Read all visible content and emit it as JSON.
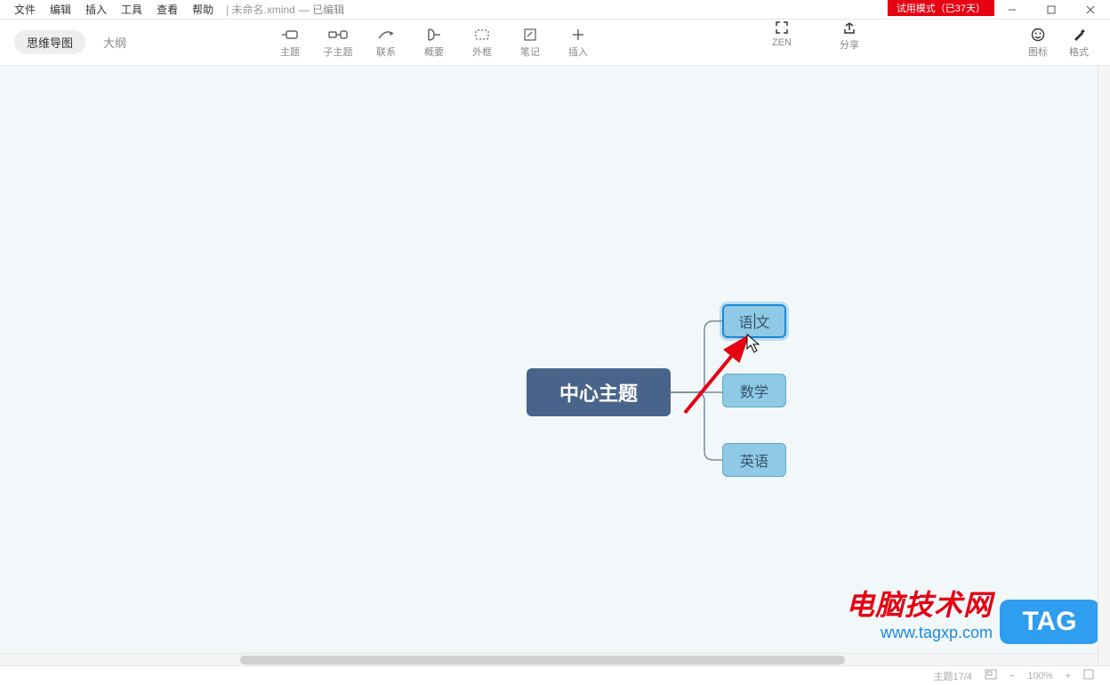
{
  "menu": {
    "file": "文件",
    "edit": "编辑",
    "insert": "插入",
    "tools": "工具",
    "view": "查看",
    "help": "帮助"
  },
  "file": {
    "name": "未命名.xmind",
    "status": "— 已编辑"
  },
  "trial": "试用模式（已37天）",
  "viewTabs": {
    "mindmap": "思维导图",
    "outline": "大纲"
  },
  "toolbar": {
    "topic": "主题",
    "subtopic": "子主题",
    "relation": "联系",
    "summary": "概要",
    "boundary": "外框",
    "note": "笔记",
    "insert": "插入",
    "zen": "ZEN",
    "share": "分享",
    "sticker": "图标",
    "format": "格式"
  },
  "nodes": {
    "central": "中心主题",
    "n1_a": "语",
    "n1_b": "文",
    "n2": "数学",
    "n3": "英语"
  },
  "status": {
    "topicCount": "主题17/4",
    "zoom": "100%"
  },
  "watermark": {
    "line1": "电脑技术网",
    "line2": "www.tagxp.com",
    "tag": "TAG"
  }
}
